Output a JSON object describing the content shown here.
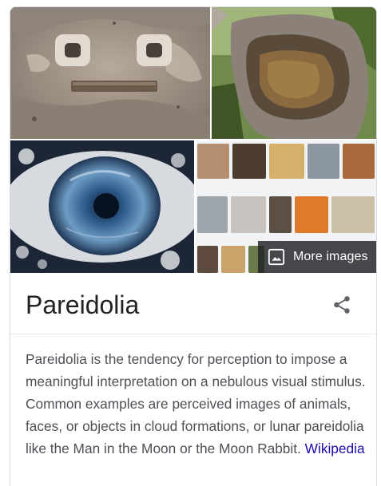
{
  "images": {
    "face": {
      "icon": "face-wall-image"
    },
    "tree": {
      "icon": "tree-hollow-image"
    },
    "eye": {
      "icon": "eye-foam-image"
    },
    "grid": {
      "icon": "thumbnail-grid-image"
    }
  },
  "more_images": {
    "label": "More images",
    "icon": "image-icon"
  },
  "knowledge": {
    "title": "Pareidolia",
    "share_icon": "share-icon",
    "description": "Pareidolia is the tendency for perception to impose a meaningful interpretation on a nebulous visual stimulus. Common examples are perceived images of animals, faces, or objects in cloud formations, or lunar pareidolia like the Man in the Moon or the Moon Rabbit.",
    "source_link": "Wikipedia"
  },
  "colors": {
    "link": "#1a0dab",
    "title": "#202124",
    "body": "#4d5156",
    "overlay": "#202124"
  }
}
